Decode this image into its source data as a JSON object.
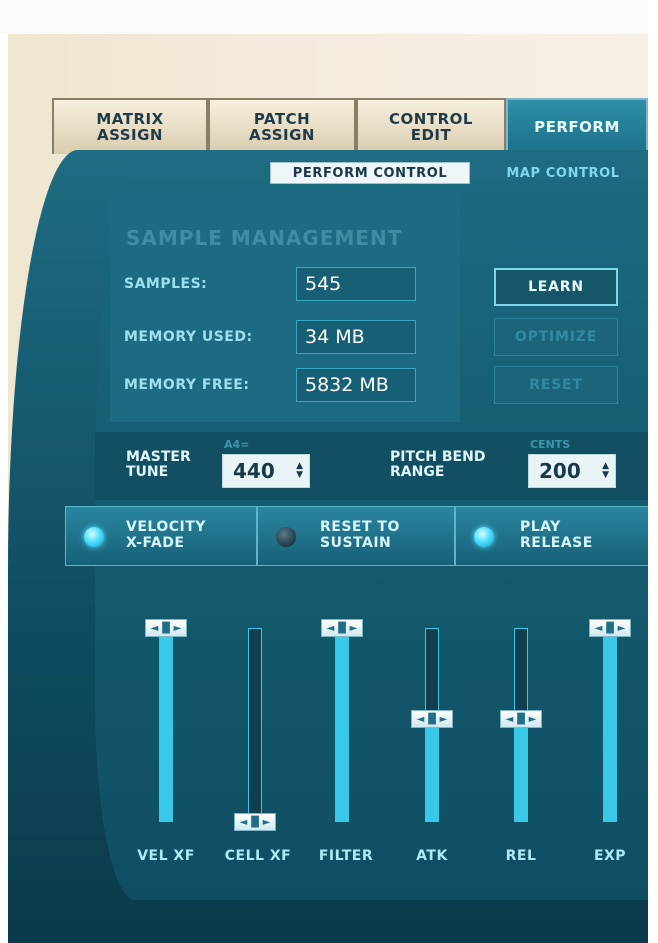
{
  "tabs": [
    {
      "label": "MATRIX\nASSIGN",
      "active": false
    },
    {
      "label": "PATCH\nASSIGN",
      "active": false
    },
    {
      "label": "CONTROL\nEDIT",
      "active": false
    },
    {
      "label": "PERFORM",
      "active": true
    }
  ],
  "subtabs": {
    "perform_control": "PERFORM CONTROL",
    "map_control": "MAP CONTROL"
  },
  "sample_management": {
    "title": "SAMPLE MANAGEMENT",
    "samples_label": "SAMPLES:",
    "samples_value": "545",
    "memory_used_label": "MEMORY USED:",
    "memory_used_value": "34 MB",
    "memory_free_label": "MEMORY FREE:",
    "memory_free_value": "5832 MB"
  },
  "buttons": {
    "learn": "LEARN",
    "optimize": "OPTIMIZE",
    "reset": "RESET"
  },
  "tuning": {
    "master_tune_label": "MASTER\nTUNE",
    "master_tune_hint": "A4=",
    "master_tune_value": "440",
    "pitch_bend_label": "PITCH BEND\nRANGE",
    "pitch_bend_hint": "CENTS",
    "pitch_bend_value": "200"
  },
  "toggles": [
    {
      "label": "VELOCITY\nX-FADE",
      "on": true
    },
    {
      "label": "RESET TO\nSUSTAIN",
      "on": false
    },
    {
      "label": "PLAY\nRELEASE",
      "on": true
    }
  ],
  "faders": [
    {
      "label": "VEL XF",
      "level": 1.0
    },
    {
      "label": "CELL XF",
      "level": 0.0
    },
    {
      "label": "FILTER",
      "level": 1.0
    },
    {
      "label": "ATK",
      "level": 0.53
    },
    {
      "label": "REL",
      "level": 0.53
    },
    {
      "label": "EXP",
      "level": 1.0
    }
  ],
  "colors": {
    "accent": "#39c9e8",
    "panel": "#1b6a80",
    "cream": "#efe6d0"
  }
}
